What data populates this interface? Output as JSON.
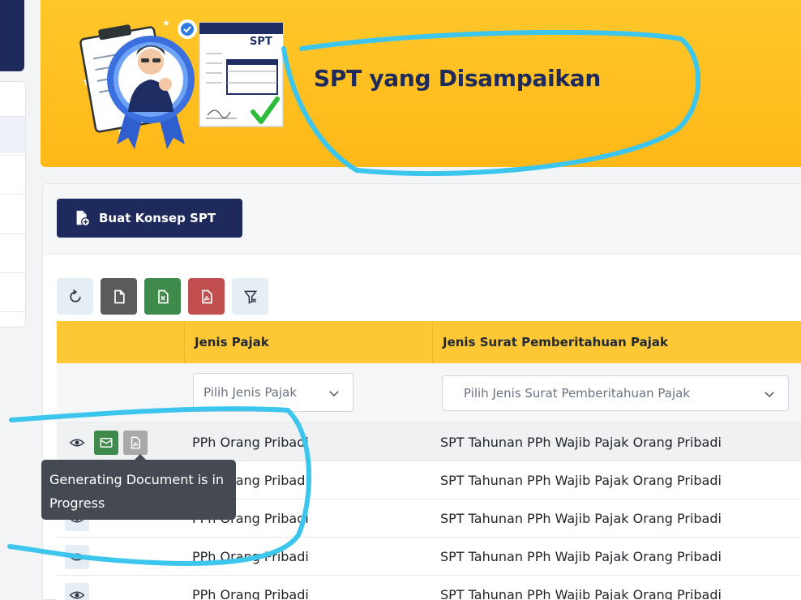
{
  "banner": {
    "title": "SPT yang Disampaikan",
    "illustration_label": "SPT"
  },
  "card": {
    "create_button_label": "Buat Konsep SPT"
  },
  "toolbar": {
    "icons": [
      "refresh-icon",
      "document-icon",
      "excel-icon",
      "pdf-icon",
      "filter-clear-icon"
    ]
  },
  "table": {
    "headers": [
      "",
      "Jenis Pajak",
      "Jenis Surat Pemberitahuan Pajak"
    ],
    "filters": {
      "jenis_pajak_placeholder": "Pilih Jenis Pajak",
      "jenis_spt_placeholder": "Pilih Jenis Surat Pemberitahuan Pajak"
    },
    "rows": [
      {
        "jenis_pajak": "PPh Orang Pribadi",
        "jenis_spt": "SPT Tahunan PPh Wajib Pajak Orang Pribadi"
      },
      {
        "jenis_pajak": "PPh Orang Pribadi",
        "jenis_spt": "SPT Tahunan PPh Wajib Pajak Orang Pribadi"
      },
      {
        "jenis_pajak": "PPh Orang Pribadi",
        "jenis_spt": "SPT Tahunan PPh Wajib Pajak Orang Pribadi"
      },
      {
        "jenis_pajak": "PPh Orang Pribadi",
        "jenis_spt": "SPT Tahunan PPh Wajib Pajak Orang Pribadi"
      },
      {
        "jenis_pajak": "PPh Orang Pribadi",
        "jenis_spt": "SPT Tahunan PPh Wajib Pajak Orang Pribadi"
      }
    ]
  },
  "tooltip": {
    "text": "Generating Document is in Progress"
  },
  "colors": {
    "navy": "#1f2a5c",
    "banner_yellow": "#ffbd1f",
    "header_yellow": "#fdc735",
    "green": "#3e8b4c",
    "red": "#c24f4f",
    "annotation_blue": "#3cc6ee"
  }
}
